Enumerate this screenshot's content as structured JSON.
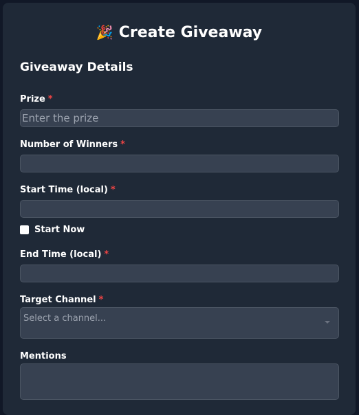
{
  "form": {
    "title": "Create Giveaway",
    "title_icon": "party-popper-icon",
    "section_title": "Giveaway Details",
    "required_marker": "*",
    "prize": {
      "label": "Prize",
      "placeholder": "Enter the prize",
      "value": ""
    },
    "winners": {
      "label": "Number of Winners",
      "value": ""
    },
    "start_time": {
      "label": "Start Time (local)",
      "value": ""
    },
    "start_now": {
      "label": "Start Now",
      "checked": false
    },
    "end_time": {
      "label": "End Time (local)",
      "value": ""
    },
    "target_channel": {
      "label": "Target Channel",
      "placeholder": "Select a channel..."
    },
    "mentions": {
      "label": "Mentions",
      "value": ""
    }
  },
  "colors": {
    "background": "#111827",
    "card": "#1f2937",
    "input": "#374151",
    "required": "#ef4444"
  }
}
